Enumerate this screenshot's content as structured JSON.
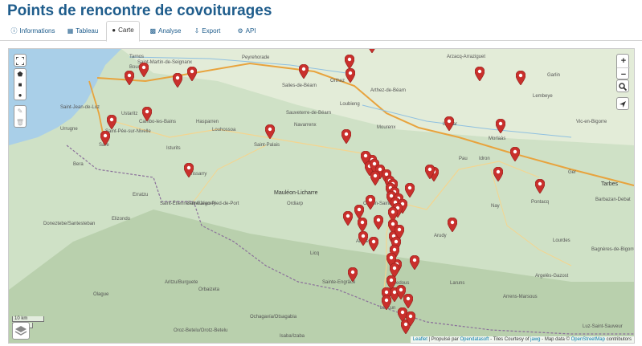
{
  "page": {
    "title": "Points de rencontre de covoiturages"
  },
  "tabs": [
    {
      "label": "Informations",
      "icon": "info-icon"
    },
    {
      "label": "Tableau",
      "icon": "table-icon"
    },
    {
      "label": "Carte",
      "icon": "globe-icon"
    },
    {
      "label": "Analyse",
      "icon": "chart-icon"
    },
    {
      "label": "Export",
      "icon": "download-icon"
    },
    {
      "label": "API",
      "icon": "gears-icon"
    }
  ],
  "map": {
    "zoom_in": "+",
    "zoom_out": "−",
    "scale_km": "10 km",
    "scale_mi": "5 mi",
    "attribution": {
      "leaflet": "Leaflet",
      "text1": " | Propulsé par ",
      "ods": "Opendatasoft",
      "text2": " - Tiles Courtesy of ",
      "jawg": "jawg",
      "text3": " - Map data © ",
      "osm": "OpenStreetMap",
      "text4": " contributors"
    },
    "places": [
      {
        "name": "Tarnos",
        "big": false
      },
      {
        "name": "Saint-Martin-de-Seignanx",
        "big": false
      },
      {
        "name": "Boucau",
        "big": false
      },
      {
        "name": "Peyrehorade",
        "big": false
      },
      {
        "name": "Salies-de-Béarn",
        "big": false
      },
      {
        "name": "Orthez",
        "big": false
      },
      {
        "name": "Arthez-de-Béarn",
        "big": false
      },
      {
        "name": "Arzacq-Arraziguet",
        "big": false
      },
      {
        "name": "Garlin",
        "big": false
      },
      {
        "name": "Lembeye",
        "big": false
      },
      {
        "name": "Saint-Jean-de-Luz",
        "big": false
      },
      {
        "name": "Urrugne",
        "big": false
      },
      {
        "name": "Saint-Pée-sur-Nivelle",
        "big": false
      },
      {
        "name": "Sare",
        "big": false
      },
      {
        "name": "Ustaritz",
        "big": false
      },
      {
        "name": "Cambo-les-Bains",
        "big": false
      },
      {
        "name": "Hasparren",
        "big": false
      },
      {
        "name": "Louhossoa",
        "big": false
      },
      {
        "name": "Isturits",
        "big": false
      },
      {
        "name": "Saint-Palais",
        "big": false
      },
      {
        "name": "Sauveterre-de-Béarn",
        "big": false
      },
      {
        "name": "Navarrenx",
        "big": false
      },
      {
        "name": "Loubieng",
        "big": false
      },
      {
        "name": "Mourenx",
        "big": false
      },
      {
        "name": "Lescar",
        "big": false
      },
      {
        "name": "Morlaàs",
        "big": false
      },
      {
        "name": "Vic-en-Bigorre",
        "big": false
      },
      {
        "name": "Pau",
        "big": false
      },
      {
        "name": "Idron",
        "big": false
      },
      {
        "name": "Ger",
        "big": false
      },
      {
        "name": "Tarbes",
        "big": true
      },
      {
        "name": "Irissarry",
        "big": false
      },
      {
        "name": "Mauléon-Licharre",
        "big": true
      },
      {
        "name": "Oloron-Sainte-Marie",
        "big": false
      },
      {
        "name": "Nay",
        "big": false
      },
      {
        "name": "Pontacq",
        "big": false
      },
      {
        "name": "Barbazan-Debat",
        "big": false
      },
      {
        "name": "Bera",
        "big": false
      },
      {
        "name": "Erratzu",
        "big": false
      },
      {
        "name": "Saint-Étienne-de-Baïgorry",
        "big": false
      },
      {
        "name": "Saint-Jean-Pied-de-Port",
        "big": false
      },
      {
        "name": "Elizondo",
        "big": false
      },
      {
        "name": "Doneztebe/Santesteban",
        "big": false
      },
      {
        "name": "Ordiarp",
        "big": false
      },
      {
        "name": "Arette",
        "big": false
      },
      {
        "name": "Arudy",
        "big": false
      },
      {
        "name": "Lourdes",
        "big": false
      },
      {
        "name": "Bagnères-de-Bigorre",
        "big": false
      },
      {
        "name": "Licq",
        "big": false
      },
      {
        "name": "Sainte-Engrâce",
        "big": false
      },
      {
        "name": "Bedous",
        "big": false
      },
      {
        "name": "Laruns",
        "big": false
      },
      {
        "name": "Argelès-Gazost",
        "big": false
      },
      {
        "name": "Aritzu/Burguete",
        "big": false
      },
      {
        "name": "Orbaizeta",
        "big": false
      },
      {
        "name": "Olague",
        "big": false
      },
      {
        "name": "Arrens-Marsous",
        "big": false
      },
      {
        "name": "Lescun",
        "big": false
      },
      {
        "name": "Ochagavía/Otsagabia",
        "big": false
      },
      {
        "name": "Oroz-Betelu/Orotz-Betelu",
        "big": false
      },
      {
        "name": "Isaba/Izaba",
        "big": false
      },
      {
        "name": "Luz-Saint-Sauveur",
        "big": false
      }
    ]
  }
}
